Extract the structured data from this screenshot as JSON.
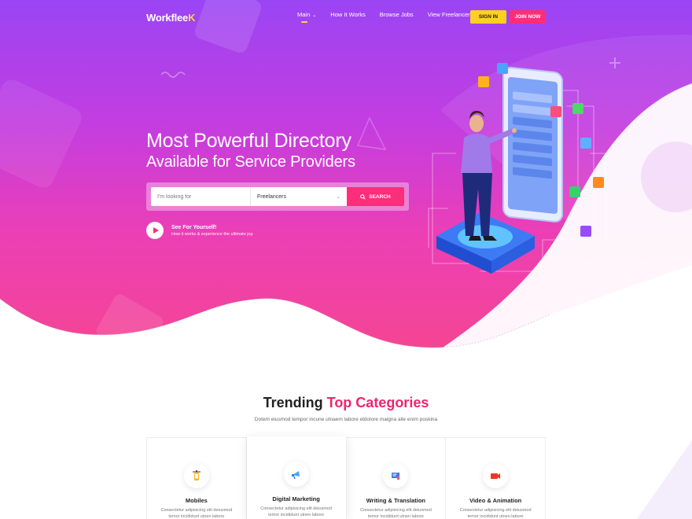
{
  "nav": {
    "logo_text": "Workflee",
    "logo_accent": "K",
    "links": [
      {
        "label": "Main",
        "active": true,
        "has_dropdown": true
      },
      {
        "label": "How It Works"
      },
      {
        "label": "Browse Jobs"
      },
      {
        "label": "View Freelancers"
      }
    ],
    "signin_label": "SIGN IN",
    "join_label": "JOIN NOW"
  },
  "hero": {
    "title_line1": "Most Powerful Directory",
    "title_line2": "Available for Service Providers",
    "search": {
      "placeholder": "I'm looking for",
      "select_value": "Freelancers",
      "button_label": "SEARCH"
    },
    "video": {
      "title": "See For Yourself!",
      "subtitle": "How it works & experience the ultimate joy."
    }
  },
  "categories": {
    "title_plain": "Trending",
    "title_highlight": "Top Categories",
    "subtitle": "Dotem eiusmod tempor incune utnaem labore etdolore maigna alie enim poskina",
    "items": [
      {
        "title": "Mobiles",
        "desc": "Consectetur adipisicing elit deiusmod temor incididunt utnen labore",
        "icon": "mobile-dev-icon"
      },
      {
        "title": "Digital Marketing",
        "desc": "Consectetur adipisicing elit deiusmod temor incididunt utnen labore",
        "icon": "megaphone-icon"
      },
      {
        "title": "Writing & Translation",
        "desc": "Consectetur adipisicing elit deiusmod temor incididunt utnen labore",
        "icon": "writing-icon"
      },
      {
        "title": "Video & Animation",
        "desc": "Consectetur adipisicing elit deiusmod temor incididunt utnen labore",
        "icon": "video-camera-icon"
      }
    ]
  },
  "colors": {
    "accent_pink": "#ff2d7a",
    "accent_yellow": "#ffd022",
    "hero_top": "#9a45f4",
    "hero_bottom": "#f5468f"
  }
}
